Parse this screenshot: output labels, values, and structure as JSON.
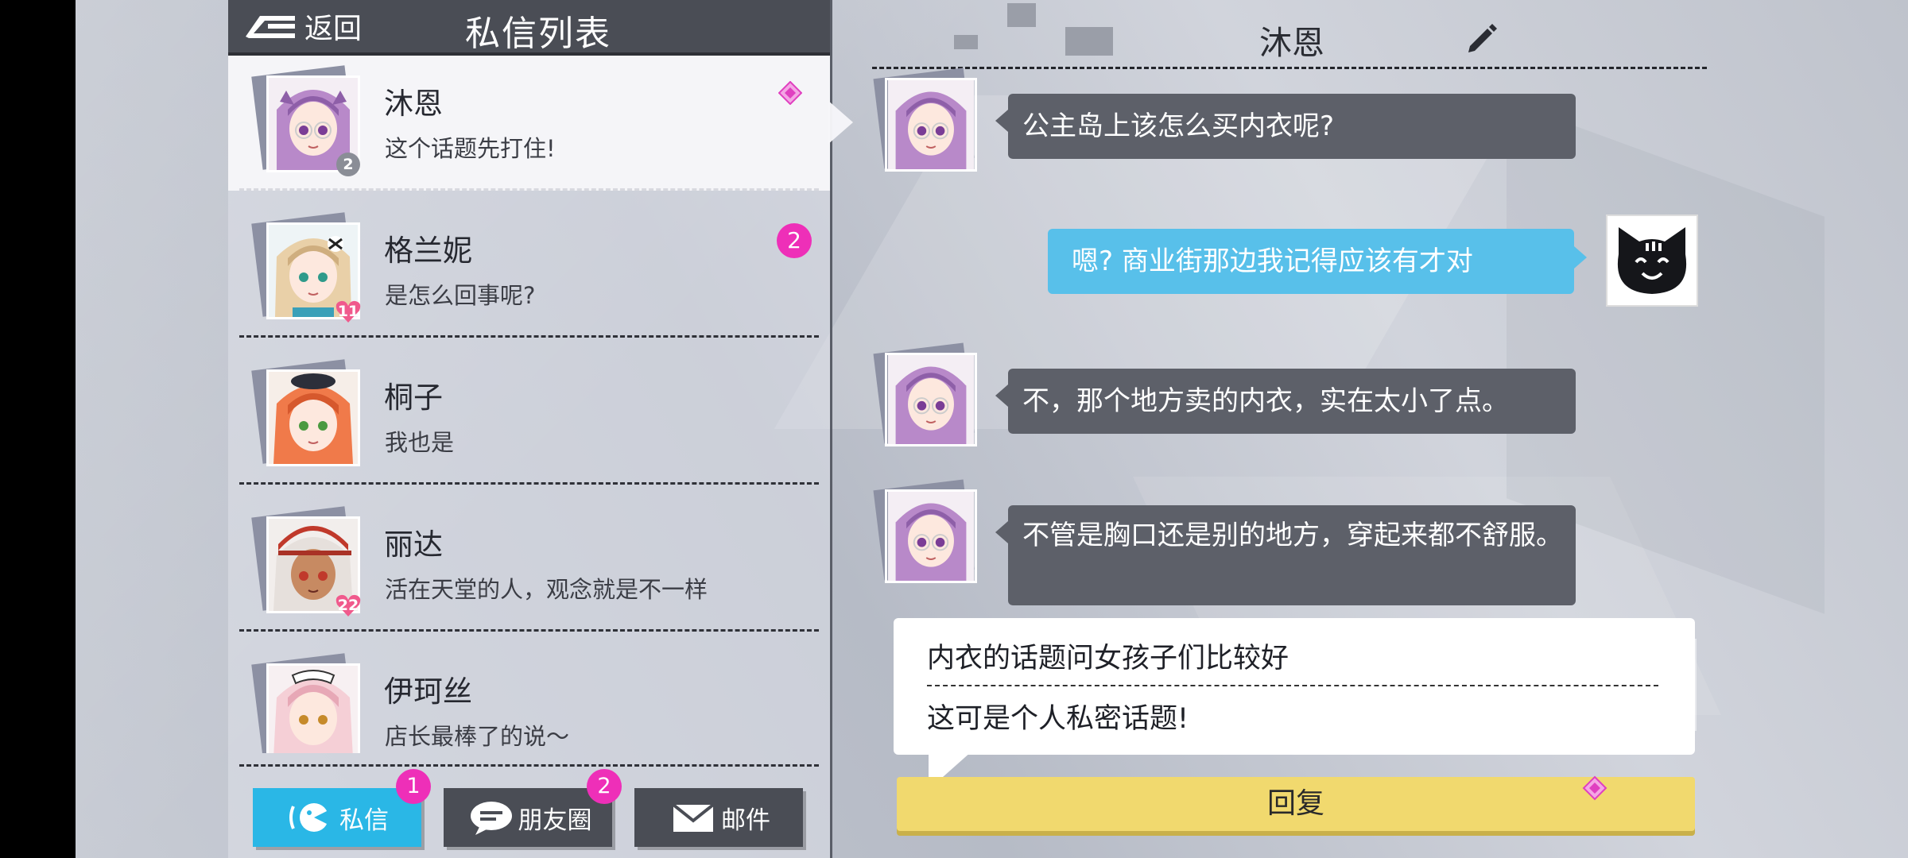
{
  "header": {
    "back_label": "返回",
    "title": "私信列表"
  },
  "contacts": [
    {
      "name": "沐恩",
      "preview": "这个话题先打住!",
      "affinity": "2",
      "badge": "",
      "hair": "#b889c9",
      "accent": "#8e5fa8"
    },
    {
      "name": "格兰妮",
      "preview": "是怎么回事呢?",
      "affinity": "11",
      "badge": "2",
      "hair": "#e9d0a8",
      "accent": "#cfae7f"
    },
    {
      "name": "桐子",
      "preview": "我也是",
      "affinity": "",
      "badge": "",
      "hair": "#f07a4a",
      "accent": "#d6582d"
    },
    {
      "name": "丽达",
      "preview": "活在天堂的人，观念就是不一样",
      "affinity": "22",
      "badge": "",
      "hair": "#e6e0dc",
      "accent": "#c0392b"
    },
    {
      "name": "伊珂丝",
      "preview": "店长最棒了的说〜",
      "affinity": "",
      "badge": "",
      "hair": "#f5cfd6",
      "accent": "#e7a8b6"
    }
  ],
  "tabs": [
    {
      "label": "私信",
      "badge": "1"
    },
    {
      "label": "朋友圈",
      "badge": "2"
    },
    {
      "label": "邮件",
      "badge": ""
    }
  ],
  "chat": {
    "name": "沐恩",
    "messages": [
      {
        "from": "npc",
        "text": "公主岛上该怎么买内衣呢?"
      },
      {
        "from": "player",
        "text": "嗯? 商业街那边我记得应该有才对"
      },
      {
        "from": "npc",
        "text": "不，那个地方卖的内衣，实在太小了点。"
      },
      {
        "from": "npc",
        "text": "不管是胸口还是别的地方，穿起来都不舒服。"
      }
    ],
    "reply_options": [
      "内衣的话题问女孩子们比较好",
      "这可是个人私密话题!"
    ],
    "reply_button": "回复"
  },
  "colors": {
    "accent_blue": "#2ab7e6",
    "badge_pink": "#ee2fb8",
    "reply_yellow": "#f1d96e",
    "npc_bubble": "#5d6069",
    "player_bubble": "#58c0ea"
  }
}
